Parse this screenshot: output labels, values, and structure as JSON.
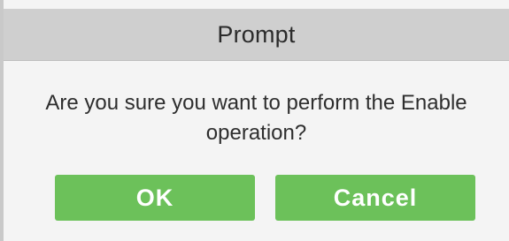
{
  "dialog": {
    "title": "Prompt",
    "message": "Are you sure you want to perform the Enable operation?",
    "buttons": {
      "ok_label": "OK",
      "cancel_label": "Cancel"
    },
    "colors": {
      "titlebar": "#cfcfcf",
      "body": "#f4f4f4",
      "button": "#6cc15a",
      "button_text": "#ffffff"
    }
  }
}
